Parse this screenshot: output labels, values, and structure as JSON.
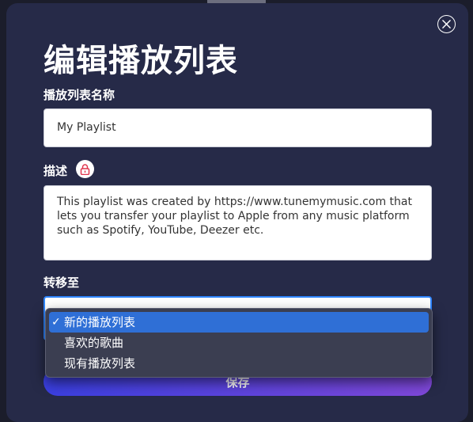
{
  "dialog": {
    "title": "编辑播放列表",
    "close_icon": "close-icon",
    "name": {
      "label": "播放列表名称",
      "value": "My Playlist"
    },
    "description": {
      "label": "描述",
      "lock_icon": "lock-icon",
      "lock_color": "#e0364f",
      "value": "This playlist was created by https://www.tunemymusic.com that lets you transfer your playlist to Apple from any music platform such as Spotify, YouTube, Deezer etc."
    },
    "transfer_to": {
      "label": "转移至",
      "options": [
        {
          "label": "新的播放列表",
          "selected": true,
          "check": "✓"
        },
        {
          "label": "喜欢的歌曲",
          "selected": false
        },
        {
          "label": "现有播放列表",
          "selected": false
        }
      ]
    },
    "save_label": "保存",
    "colors": {
      "dialog_bg": "#262a48",
      "accent_start": "#3a3fe0",
      "accent_end": "#7f48d9",
      "focus_border": "#2f86ff",
      "selected_option": "#2f6fd6"
    }
  }
}
